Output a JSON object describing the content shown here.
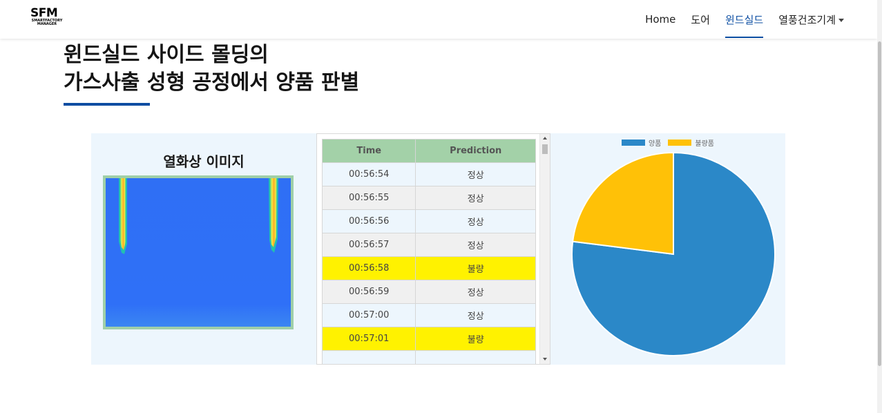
{
  "nav": {
    "logo_main": "SFM",
    "logo_sub": "SMARTFACTORY MANAGER",
    "items": [
      {
        "label": "Home"
      },
      {
        "label": "도어"
      },
      {
        "label": "윈드실드"
      },
      {
        "label": "열풍건조기계"
      }
    ]
  },
  "page": {
    "title_line1": "윈드실드 사이드 몰딩의",
    "title_line2": "가스사출 성형 공정에서 양품 판별"
  },
  "thermal": {
    "title": "열화상 이미지"
  },
  "table": {
    "headers": [
      "Time",
      "Prediction"
    ],
    "rows": [
      {
        "time": "00:56:54",
        "prediction": "정상"
      },
      {
        "time": "00:56:55",
        "prediction": "정상"
      },
      {
        "time": "00:56:56",
        "prediction": "정상"
      },
      {
        "time": "00:56:57",
        "prediction": "정상"
      },
      {
        "time": "00:56:58",
        "prediction": "불량"
      },
      {
        "time": "00:56:59",
        "prediction": "정상"
      },
      {
        "time": "00:57:00",
        "prediction": "정상"
      },
      {
        "time": "00:57:01",
        "prediction": "불량"
      },
      {
        "time": "",
        "prediction": ""
      }
    ],
    "defect_color": "#fff200"
  },
  "chart_data": {
    "type": "pie",
    "categories": [
      "양품",
      "불량품"
    ],
    "values": [
      77,
      23
    ],
    "colors": [
      "#2b88c8",
      "#ffc107"
    ],
    "legend": "top"
  }
}
